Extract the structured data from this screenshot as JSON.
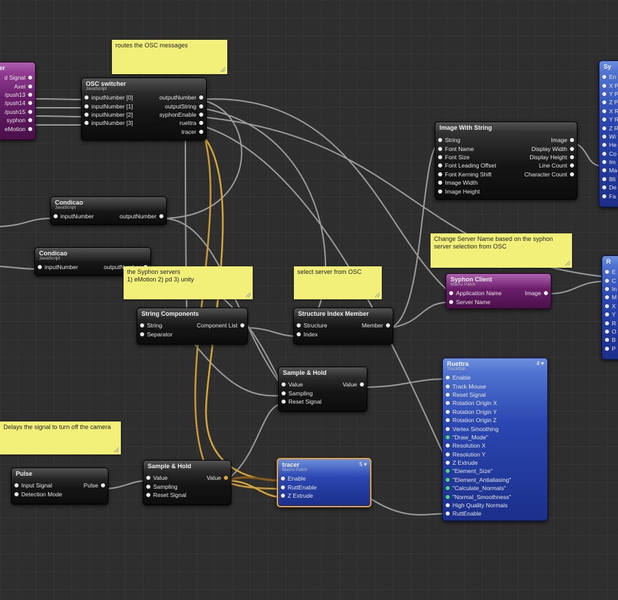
{
  "notes": {
    "osc_routes": "routes the OSC messages",
    "syphon_servers": "the Syphon servers\n1) eMotion 2) pd   3) unity",
    "select_server": "select server from OSC",
    "change_server_name": "Change Server Name based on the syphon server selection from OSC",
    "delays_signal": "Delays the signal to turn off the camera"
  },
  "patches": {
    "left_partial": {
      "title": "er",
      "outputs": [
        "d Signal",
        "Axel",
        "/push13",
        "/push14",
        "/push15",
        "syphon",
        "eMotion"
      ]
    },
    "osc_switcher": {
      "title": "OSC switcher",
      "subtitle": "JavaScript",
      "inputs": [
        "inputNumber [0]",
        "inputNumber [1]",
        "inputNumber [2]",
        "inputNumber [3]"
      ],
      "outputs": [
        "outputNumber",
        "outputString",
        "syphonEnable",
        "ruettra",
        "tracer"
      ]
    },
    "condicao1": {
      "title": "Condicao",
      "subtitle": "JavaScript",
      "inputs": [
        "inputNumber"
      ],
      "outputs": [
        "outputNumber"
      ]
    },
    "condicao2": {
      "title": "Condicao",
      "subtitle": "JavaScript",
      "inputs": [
        "inputNumber"
      ],
      "outputs": [
        "outputNumber"
      ]
    },
    "image_with_string": {
      "title": "Image With String",
      "inputs": [
        "String",
        "Font Name",
        "Font Size",
        "Font Leading Offset",
        "Font Kerning Shift",
        "Image Width",
        "Image Height"
      ],
      "outputs": [
        "Image",
        "Display Width",
        "Display Height",
        "Line Count",
        "Character Count"
      ]
    },
    "string_components": {
      "title": "String Components",
      "inputs": [
        "String",
        "Separator"
      ],
      "outputs": [
        "Component List"
      ]
    },
    "structure_index_member": {
      "title": "Structure Index Member",
      "inputs": [
        "Structure",
        "Index"
      ],
      "outputs": [
        "Member"
      ]
    },
    "syphon_client": {
      "title": "Syphon Client",
      "subtitle": "Macro Patch",
      "inputs": [
        "Application Name",
        "Server Name"
      ],
      "outputs": [
        "Image"
      ]
    },
    "sample_hold1": {
      "title": "Sample & Hold",
      "inputs": [
        "Value",
        "Sampling",
        "Reset Signal"
      ],
      "outputs": [
        "Value"
      ]
    },
    "sample_hold2": {
      "title": "Sample & Hold",
      "inputs": [
        "Value",
        "Sampling",
        "Reset Signal"
      ],
      "outputs": [
        "Value"
      ]
    },
    "pulse": {
      "title": "Pulse",
      "inputs": [
        "Input Signal",
        "Detection Mode"
      ],
      "outputs": [
        "Pulse"
      ]
    },
    "tracer": {
      "title": "tracer",
      "subtitle": "Macro Patch",
      "badge": "5",
      "inputs": [
        "Enable",
        "RuttEnable",
        "Z Extrude"
      ]
    },
    "ruettra": {
      "title": "Ruettra",
      "subtitle": "TrackBall",
      "badge": "4",
      "inputs": [
        "Enable",
        "Track Mouse",
        "Reset Signal",
        "Rotation Origin X",
        "Rotation Origin Y",
        "Rotation Origin Z",
        "Vertex Smoothing",
        "\"Draw_Mode\"",
        "Resolution X",
        "Resolution Y",
        "Z Extrude",
        "\"Element_Size\"",
        "\"Element_Antialiasing\"",
        "\"Calculate_Normals\"",
        "\"Normal_Smoothness\"",
        "High Quality Normals",
        "RuttEnable"
      ],
      "green_from": 7
    },
    "right_top_partial": {
      "title": "Sy",
      "inputs": [
        "En",
        "X P",
        "Y P",
        "Z P",
        "X R",
        "Y R",
        "Z R",
        "Wi",
        "He",
        "Co",
        "Im",
        "Ma",
        "Bli",
        "De",
        "Fa"
      ]
    },
    "right_mid_partial": {
      "title": "R",
      "inputs": [
        "E",
        "C",
        "In",
        "M",
        "X",
        "Y",
        "R",
        "O",
        "B",
        "P"
      ]
    }
  },
  "colors": {
    "canvas": "#2e2e2e",
    "note": "#f3f07a",
    "wire": "#a8a8a8",
    "wire_active": "#d6a83a",
    "macro_purple": "#6a1e6a",
    "consumer_blue": "#2a46b0"
  }
}
